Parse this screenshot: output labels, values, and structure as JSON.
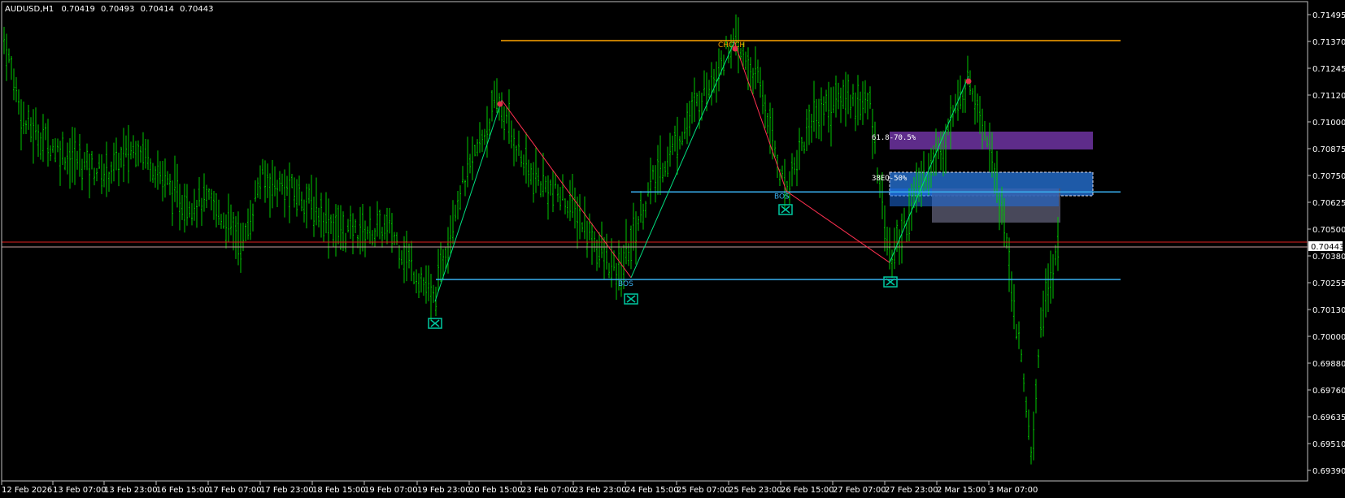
{
  "header": {
    "symbol": "AUDUSD,H1",
    "open": "0.70419",
    "high": "0.70493",
    "low": "0.70414",
    "close": "0.70443"
  },
  "colors": {
    "background": "#000000",
    "candle": "#00c800",
    "axis": "#c0c0c0",
    "choch_line": "#ffa500",
    "bos_line": "#39b0f0",
    "down_leg": "#ff3050",
    "up_leg": "#00e080",
    "marker_box": "#00c8a0",
    "price_line_red": "#e02020",
    "fib_zone": "#5e2c8a",
    "eq_zone": "#1e5aa8",
    "grey_zone": "#55556a",
    "blue_zone": "#1e6ee0"
  },
  "chart_data": {
    "type": "candlestick",
    "symbol": "AUDUSD",
    "timeframe": "H1",
    "y_ticks": [
      "0.71495",
      "0.71370",
      "0.71245",
      "0.71120",
      "0.71000",
      "0.70875",
      "0.70750",
      "0.70625",
      "0.70500",
      "0.70380",
      "0.70255",
      "0.70130",
      "0.70000",
      "0.69880",
      "0.69760",
      "0.69635",
      "0.69510",
      "0.69390"
    ],
    "x_ticks": [
      "12 Feb 2026",
      "13 Feb 07:00",
      "13 Feb 23:00",
      "16 Feb 15:00",
      "17 Feb 07:00",
      "17 Feb 23:00",
      "18 Feb 15:00",
      "19 Feb 07:00",
      "19 Feb 23:00",
      "20 Feb 15:00",
      "23 Feb 07:00",
      "23 Feb 23:00",
      "24 Feb 15:00",
      "25 Feb 07:00",
      "25 Feb 23:00",
      "26 Feb 15:00",
      "27 Feb 07:00",
      "27 Feb 23:00",
      "2 Mar 15:00",
      "3 Mar 07:00"
    ],
    "y_range": [
      0.6939,
      0.71495
    ],
    "current_price": "0.70443",
    "levels": [
      {
        "label": "CHOCH",
        "price": 0.71375
      },
      {
        "label": "BOS",
        "price": 0.70676
      },
      {
        "label": "BOS",
        "price": 0.70272
      }
    ],
    "zone_labels": [
      "61.8-70.5%",
      "38EQ-50%"
    ],
    "swing_points": [
      {
        "x": "19 Feb 23:00",
        "y": 0.7017
      },
      {
        "x": "20 Feb 15:00",
        "y": 0.711
      },
      {
        "x": "24 Feb 15:00",
        "y": 0.7028
      },
      {
        "x": "25 Feb 23:00",
        "y": 0.7137
      },
      {
        "x": "26 Feb 15:00",
        "y": 0.7068
      },
      {
        "x": "27 Feb 23:00",
        "y": 0.7035
      },
      {
        "x": "2 Mar 15:00",
        "y": 0.7121
      }
    ]
  }
}
